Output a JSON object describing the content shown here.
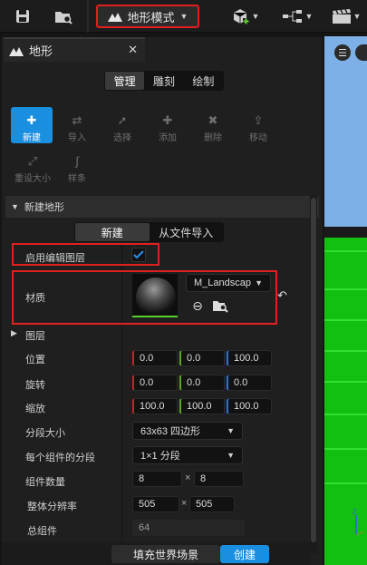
{
  "toolbar": {
    "mode_label": "地形模式"
  },
  "panel": {
    "tab_title": "地形",
    "subtabs": [
      "管理",
      "雕刻",
      "绘制"
    ],
    "tools": [
      {
        "label": "新建"
      },
      {
        "label": "导入"
      },
      {
        "label": "选择"
      },
      {
        "label": "添加"
      },
      {
        "label": "删除"
      },
      {
        "label": "移动"
      },
      {
        "label": "重设大小"
      },
      {
        "label": "样条"
      }
    ],
    "new_landscape_header": "新建地形",
    "import_tabs": [
      "新建",
      "从文件导入"
    ],
    "enable_edit_layers_label": "启用编辑图层",
    "material_label": "材质",
    "material_value": "M_Landscap",
    "layers_label": "图层",
    "location_label": "位置",
    "location": [
      "0.0",
      "0.0",
      "100.0"
    ],
    "rotation_label": "旋转",
    "rotation": [
      "0.0",
      "0.0",
      "0.0"
    ],
    "scale_label": "缩放",
    "scale": [
      "100.0",
      "100.0",
      "100.0"
    ],
    "section_size_label": "分段大小",
    "section_size_value": "63x63 四边形",
    "sections_per_component_label": "每个组件的分段",
    "sections_per_component_value": "1×1 分段",
    "component_count_label": "组件数量",
    "component_count": [
      "8",
      "8"
    ],
    "overall_resolution_label": "整体分辨率",
    "overall_resolution": [
      "505",
      "505"
    ],
    "total_components_label": "总组件",
    "total_components": "64",
    "fill_world_button": "填充世界场景",
    "create_button": "创建"
  }
}
